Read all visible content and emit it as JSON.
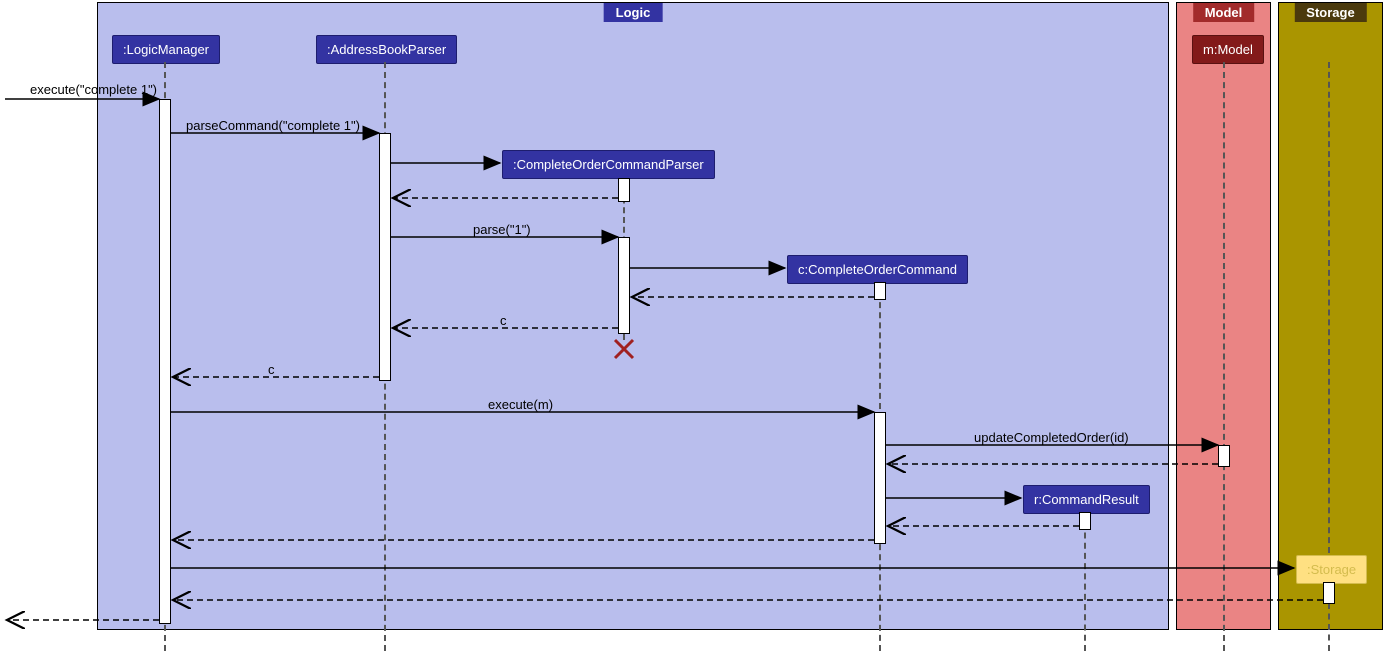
{
  "frames": {
    "logic": "Logic",
    "model": "Model",
    "storage": "Storage"
  },
  "participants": {
    "logicManager": ":LogicManager",
    "addressBookParser": ":AddressBookParser",
    "completeOrderCommandParser": ":CompleteOrderCommandParser",
    "completeOrderCommand": "c:CompleteOrderCommand",
    "commandResult": "r:CommandResult",
    "model": "m:Model",
    "storage": ":Storage"
  },
  "messages": {
    "execute1": "execute(\"complete 1\")",
    "parseCommand": "parseCommand(\"complete 1\")",
    "parse1": "parse(\"1\")",
    "returnC1": "c",
    "returnC2": "c",
    "executeM": "execute(m)",
    "updateCompleted": "updateCompletedOrder(id)"
  },
  "chart_data": {
    "type": "sequence_diagram",
    "frames": [
      {
        "name": "Logic",
        "color": "#B9BEED"
      },
      {
        "name": "Model",
        "color": "#EA8484"
      },
      {
        "name": "Storage",
        "color": "#AA9500"
      }
    ],
    "participants": [
      {
        "id": "LM",
        "label": ":LogicManager",
        "frame": "Logic"
      },
      {
        "id": "ABP",
        "label": ":AddressBookParser",
        "frame": "Logic"
      },
      {
        "id": "COCP",
        "label": ":CompleteOrderCommandParser",
        "frame": "Logic",
        "created_by": "ABP"
      },
      {
        "id": "COC",
        "label": "c:CompleteOrderCommand",
        "frame": "Logic",
        "created_by": "COCP"
      },
      {
        "id": "CR",
        "label": "r:CommandResult",
        "frame": "Logic",
        "created_by": "COC"
      },
      {
        "id": "M",
        "label": "m:Model",
        "frame": "Model"
      },
      {
        "id": "S",
        "label": ":Storage",
        "frame": "Storage"
      }
    ],
    "messages": [
      {
        "from": "external",
        "to": "LM",
        "label": "execute(\"complete 1\")",
        "type": "sync"
      },
      {
        "from": "LM",
        "to": "ABP",
        "label": "parseCommand(\"complete 1\")",
        "type": "sync"
      },
      {
        "from": "ABP",
        "to": "COCP",
        "label": "",
        "type": "create"
      },
      {
        "from": "COCP",
        "to": "ABP",
        "label": "",
        "type": "return"
      },
      {
        "from": "ABP",
        "to": "COCP",
        "label": "parse(\"1\")",
        "type": "sync"
      },
      {
        "from": "COCP",
        "to": "COC",
        "label": "",
        "type": "create"
      },
      {
        "from": "COC",
        "to": "COCP",
        "label": "",
        "type": "return"
      },
      {
        "from": "COCP",
        "to": "ABP",
        "label": "c",
        "type": "return"
      },
      {
        "from": "COCP",
        "to": null,
        "label": "",
        "type": "destroy"
      },
      {
        "from": "ABP",
        "to": "LM",
        "label": "c",
        "type": "return"
      },
      {
        "from": "LM",
        "to": "COC",
        "label": "execute(m)",
        "type": "sync"
      },
      {
        "from": "COC",
        "to": "M",
        "label": "updateCompletedOrder(id)",
        "type": "sync"
      },
      {
        "from": "M",
        "to": "COC",
        "label": "",
        "type": "return"
      },
      {
        "from": "COC",
        "to": "CR",
        "label": "",
        "type": "create"
      },
      {
        "from": "CR",
        "to": "COC",
        "label": "",
        "type": "return"
      },
      {
        "from": "COC",
        "to": "LM",
        "label": "",
        "type": "return"
      },
      {
        "from": "LM",
        "to": "S",
        "label": "",
        "type": "sync"
      },
      {
        "from": "S",
        "to": "LM",
        "label": "",
        "type": "return"
      },
      {
        "from": "LM",
        "to": "external",
        "label": "",
        "type": "return"
      }
    ]
  }
}
